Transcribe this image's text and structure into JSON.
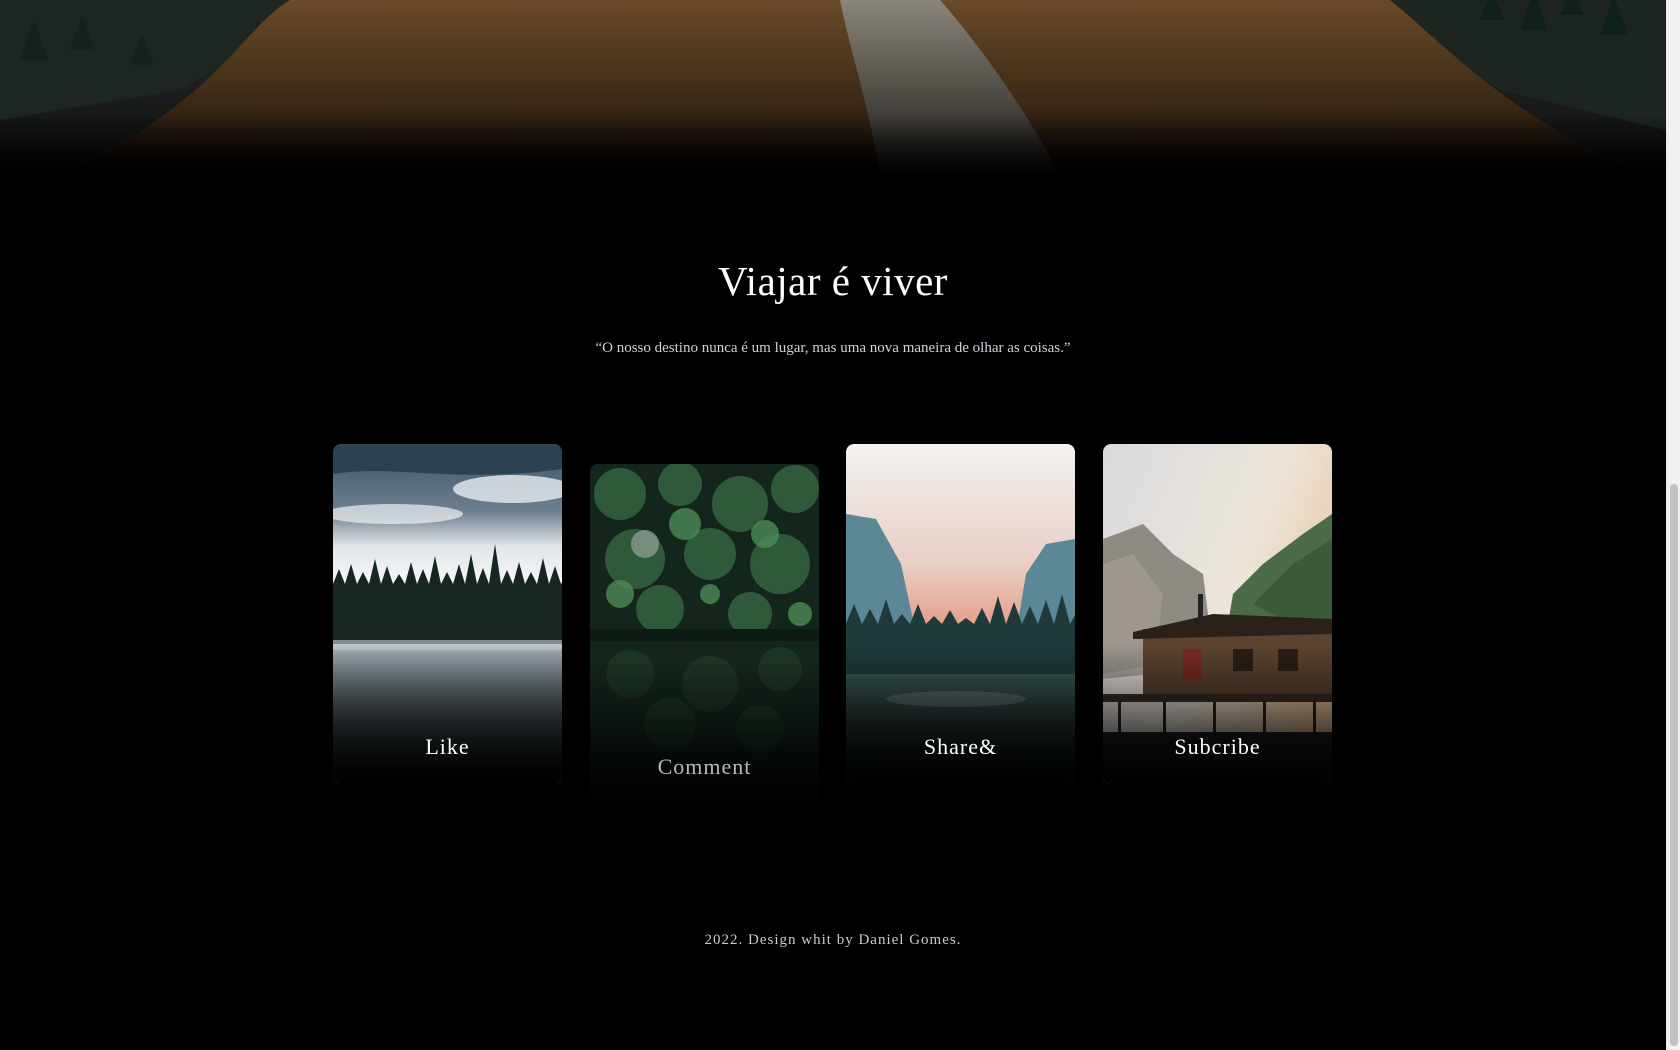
{
  "hero": {
    "image": "mountain-trail-landscape"
  },
  "section": {
    "title": "Viajar é viver",
    "quote": "“O nosso destino nunca é um lugar, mas uma nova maneira de olhar as coisas.”"
  },
  "cards": [
    {
      "label": "Like",
      "image": "misty-lake-forest"
    },
    {
      "label": "Comment",
      "image": "aerial-forest-lake"
    },
    {
      "label": "Share&",
      "image": "valley-sunset-cliffs"
    },
    {
      "label": "Subcribe",
      "image": "mountain-lake-cabin"
    }
  ],
  "footer": {
    "text": "2022. Design whit by Daniel Gomes."
  },
  "colors": {
    "background": "#000000",
    "text": "#ffffff",
    "muted": "#cfd2dc"
  }
}
